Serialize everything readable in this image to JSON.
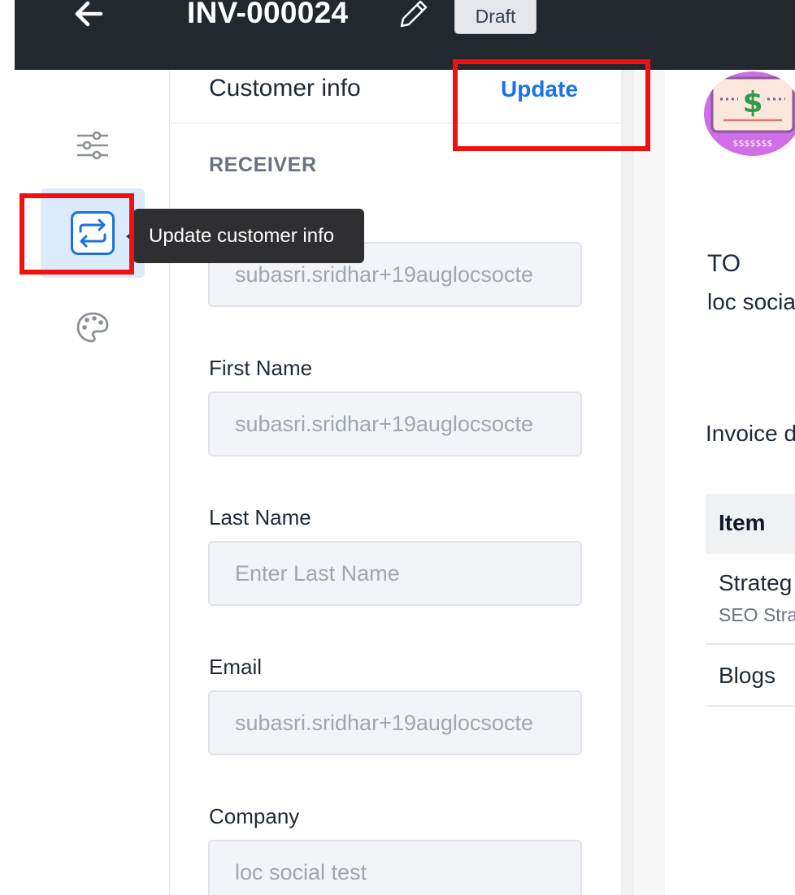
{
  "header": {
    "invoice_number": "INV-000024",
    "status_badge": "Draft",
    "back_icon": "arrow-left-icon",
    "edit_icon": "pencil-icon"
  },
  "sidebar": {
    "items": [
      {
        "icon": "sliders-icon",
        "active": false
      },
      {
        "icon": "swap-arrows-icon",
        "active": true
      },
      {
        "icon": "palette-icon",
        "active": false
      }
    ],
    "tooltip": "Update customer info"
  },
  "customer_panel": {
    "title": "Customer info",
    "update_label": "Update",
    "section_label": "RECEIVER",
    "fields": [
      {
        "label": "",
        "value": "subasri.sridhar+19auglocsocte",
        "placeholder": ""
      },
      {
        "label": "First Name",
        "value": "subasri.sridhar+19auglocsocte",
        "placeholder": ""
      },
      {
        "label": "Last Name",
        "value": "",
        "placeholder": "Enter Last Name"
      },
      {
        "label": "Email",
        "value": "subasri.sridhar+19auglocsocte",
        "placeholder": ""
      },
      {
        "label": "Company",
        "value": "loc social test",
        "placeholder": ""
      }
    ]
  },
  "preview": {
    "to_label": "TO",
    "to_company": "loc socia",
    "invoice_date_label": "Invoice d",
    "table_header": "Item",
    "rows": [
      {
        "title": "Strateg",
        "subtitle": "SEO Stra"
      },
      {
        "title": "Blogs",
        "subtitle": ""
      }
    ],
    "logo_text": "$$$$$$$"
  },
  "colors": {
    "accent": "#1a73e8",
    "topbar": "#23272e",
    "highlight": "#f01010",
    "active_bg": "#dbeafe"
  }
}
